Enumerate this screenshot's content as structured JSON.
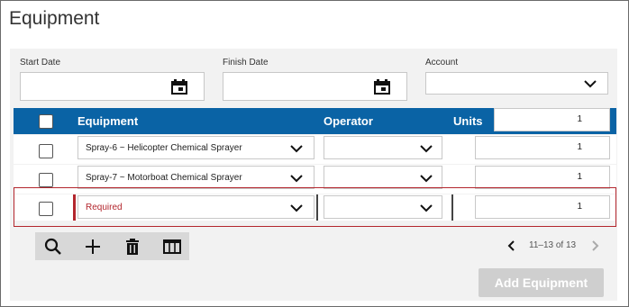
{
  "page": {
    "title": "Equipment"
  },
  "filters": {
    "start_label": "Start Date",
    "finish_label": "Finish Date",
    "account_label": "Account"
  },
  "table": {
    "columns": {
      "equipment": "Equipment",
      "operator": "Operator",
      "units": "Units"
    },
    "header_units_value": "1",
    "rows": [
      {
        "equipment": "Spray-6 ~ Helicopter Chemical Sprayer",
        "operator": "",
        "units": "1"
      },
      {
        "equipment": "Spray-7 ~ Motorboat Chemical Sprayer",
        "operator": "",
        "units": "1"
      },
      {
        "equipment": "Required",
        "operator": "",
        "units": "1"
      }
    ]
  },
  "toolbar": {
    "icons": [
      "search-icon",
      "plus-icon",
      "trash-icon",
      "columns-icon"
    ]
  },
  "pagination": {
    "range": "11–13 of 13"
  },
  "actions": {
    "add_label": "Add Equipment"
  },
  "colors": {
    "header": "#0a63a5",
    "error": "#b3262d",
    "disabled_button": "#cfcfcf"
  }
}
